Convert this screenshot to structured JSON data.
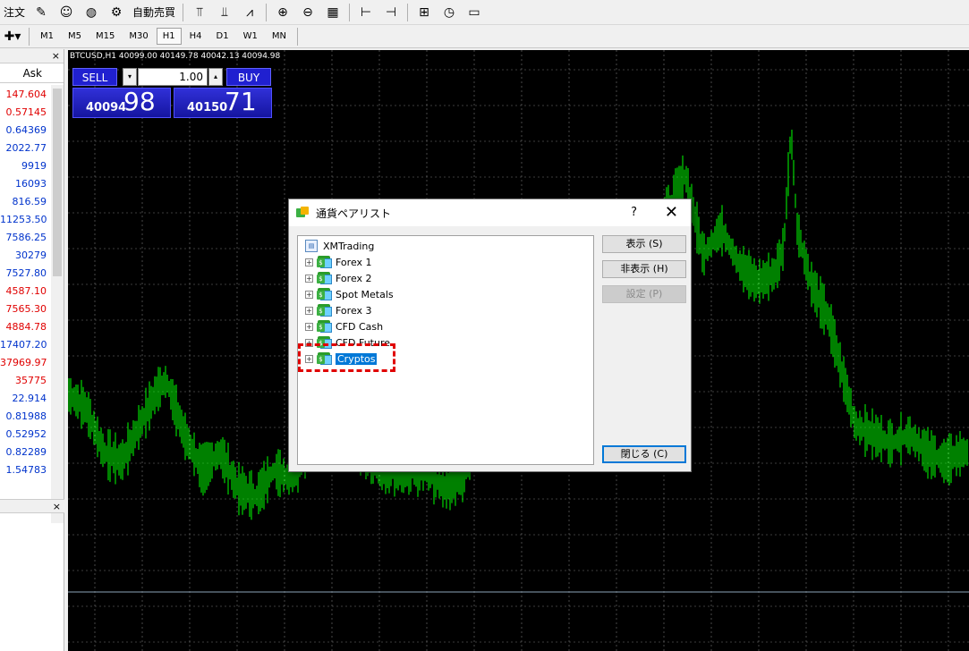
{
  "toolbar": {
    "order_label": "注文",
    "auto_trade_label": "自動売買"
  },
  "timeframes": [
    "M1",
    "M5",
    "M15",
    "M30",
    "H1",
    "H4",
    "D1",
    "W1",
    "MN"
  ],
  "active_timeframe": "H1",
  "market_watch": {
    "ask_header": "Ask",
    "asks": [
      {
        "value": "147.604",
        "color": "red"
      },
      {
        "value": "0.57145",
        "color": "red"
      },
      {
        "value": "0.64369",
        "color": "blue"
      },
      {
        "value": "2022.77",
        "color": "blue"
      },
      {
        "value": "9919",
        "color": "blue"
      },
      {
        "value": "16093",
        "color": "blue"
      },
      {
        "value": "816.59",
        "color": "blue"
      },
      {
        "value": "11253.50",
        "color": "blue"
      },
      {
        "value": "7586.25",
        "color": "blue"
      },
      {
        "value": "30279",
        "color": "blue"
      },
      {
        "value": "7527.80",
        "color": "blue"
      },
      {
        "value": "4587.10",
        "color": "red"
      },
      {
        "value": "7565.30",
        "color": "red"
      },
      {
        "value": "4884.78",
        "color": "red"
      },
      {
        "value": "17407.20",
        "color": "blue"
      },
      {
        "value": "37969.97",
        "color": "red"
      },
      {
        "value": "35775",
        "color": "red"
      },
      {
        "value": "22.914",
        "color": "blue"
      },
      {
        "value": "0.81988",
        "color": "blue"
      },
      {
        "value": "0.52952",
        "color": "blue"
      },
      {
        "value": "0.82289",
        "color": "blue"
      },
      {
        "value": "1.54783",
        "color": "blue"
      }
    ]
  },
  "chart": {
    "info": "BTCUSD,H1  40099.00 40149.78 40042.13 40094.98",
    "sell_label": "SELL",
    "buy_label": "BUY",
    "lot": "1.00",
    "sell_small": "40094",
    "sell_big": "98",
    "buy_small": "40150",
    "buy_big": "71"
  },
  "dialog": {
    "title": "通貨ペアリスト",
    "help": "?",
    "close": "✕",
    "root": "XMTrading",
    "groups": [
      "Forex 1",
      "Forex 2",
      "Spot Metals",
      "Forex 3",
      "CFD Cash",
      "CFD Future",
      "Cryptos"
    ],
    "selected": "Cryptos",
    "buttons": {
      "show": "表示 (S)",
      "hide": "非表示 (H)",
      "settings": "設定 (P)",
      "close": "閉じる (C)"
    }
  },
  "colors": {
    "candle": "#00ff00",
    "chart_bg": "#000000",
    "selection": "#0078d7",
    "highlight": "#e00000"
  }
}
